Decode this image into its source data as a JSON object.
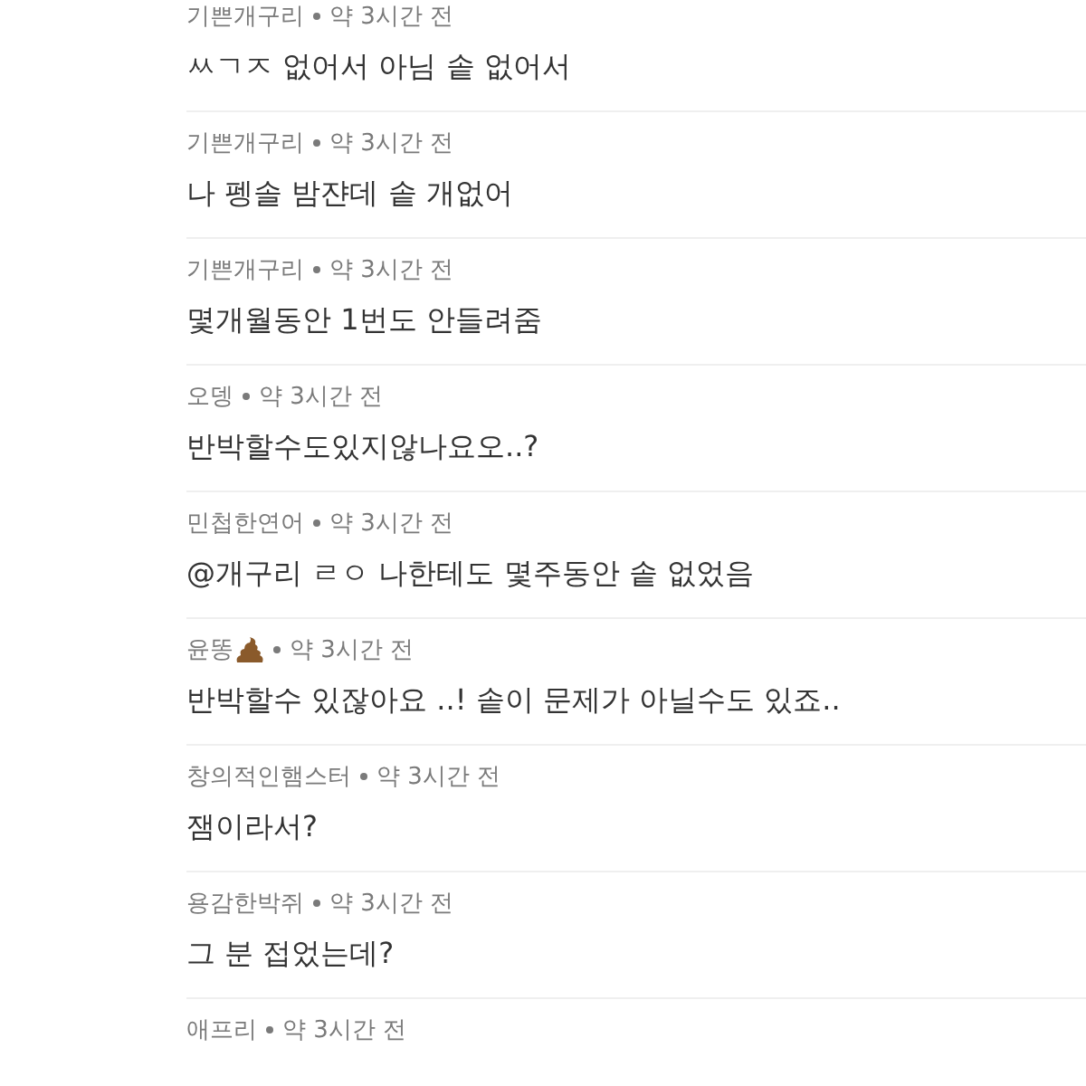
{
  "comments": [
    {
      "author": "기쁜개구리",
      "author_icon": false,
      "time": "약 3시간 전",
      "body": "ㅆㄱㅈ 없어서 아님 솥 없어서"
    },
    {
      "author": "기쁜개구리",
      "author_icon": false,
      "time": "약 3시간 전",
      "body": "나 펭솔 밤쟌데 솥 개없어"
    },
    {
      "author": "기쁜개구리",
      "author_icon": false,
      "time": "약 3시간 전",
      "body": "몇개월동안 1번도 안들려줌"
    },
    {
      "author": "오뎅",
      "author_icon": false,
      "time": "약 3시간 전",
      "body": "반박할수도있지않나요오..?"
    },
    {
      "author": "민첩한연어",
      "author_icon": false,
      "time": "약 3시간 전",
      "body": "@개구리 ㄹㅇ 나한테도 몇주동안 솥 없었음"
    },
    {
      "author": "윤똥",
      "author_icon": true,
      "time": "약 3시간 전",
      "body": "반박할수 있잖아요 ..! 솥이 문제가 아닐수도 있죠.."
    },
    {
      "author": "창의적인햄스터",
      "author_icon": false,
      "time": "약 3시간 전",
      "body": "잼이라서?"
    },
    {
      "author": "용감한박쥐",
      "author_icon": false,
      "time": "약 3시간 전",
      "body": "그 분 접었는데?"
    },
    {
      "author": "애프리",
      "author_icon": false,
      "time": "약 3시간 전"
    }
  ]
}
